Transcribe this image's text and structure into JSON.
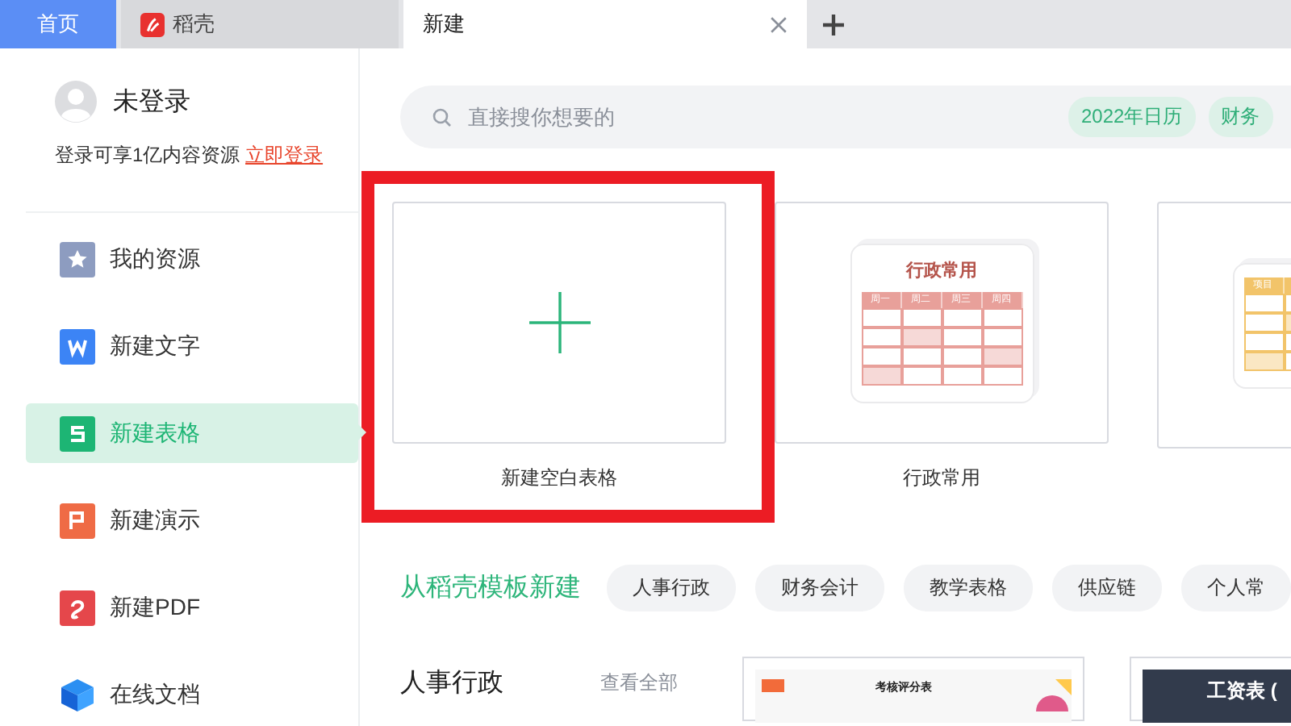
{
  "tabs": [
    {
      "label": "首页",
      "kind": "home",
      "selected": false
    },
    {
      "label": "稻壳",
      "kind": "docer",
      "selected": false
    },
    {
      "label": "新建",
      "kind": "plain",
      "selected": true
    }
  ],
  "user": {
    "name": "未登录",
    "promo": "登录可享1亿内容资源",
    "login_link": "立即登录"
  },
  "sidebar": {
    "items": [
      {
        "label": "我的资源",
        "kind": "star",
        "selected": false
      },
      {
        "label": "新建文字",
        "kind": "word",
        "selected": false
      },
      {
        "label": "新建表格",
        "kind": "sheet",
        "selected": true
      },
      {
        "label": "新建演示",
        "kind": "slides",
        "selected": false
      },
      {
        "label": "新建PDF",
        "kind": "pdf",
        "selected": false
      },
      {
        "label": "在线文档",
        "kind": "cloud",
        "selected": false
      }
    ]
  },
  "search": {
    "placeholder": "直接搜你想要的",
    "tags": [
      "2022年日历",
      "财务"
    ]
  },
  "cards": [
    {
      "kind": "blank",
      "label": "新建空白表格",
      "highlighted": true
    },
    {
      "kind": "template",
      "label": "行政常用",
      "title": "行政常用",
      "header": [
        "周一",
        "周二",
        "周三",
        "周四"
      ],
      "color": "#e8a09a",
      "highlighted": false
    },
    {
      "kind": "template",
      "header": [
        "项目"
      ],
      "color": "#f2c46a",
      "highlighted": false
    }
  ],
  "templates": {
    "title": "从稻壳模板新建",
    "categories": [
      "人事行政",
      "财务会计",
      "教学表格",
      "供应链",
      "个人常"
    ]
  },
  "section": {
    "title": "人事行政",
    "more": "查看全部",
    "thumbs": [
      {
        "kind": "score",
        "title": "考核评分表"
      },
      {
        "kind": "salary",
        "title": "工资表 ("
      }
    ]
  }
}
